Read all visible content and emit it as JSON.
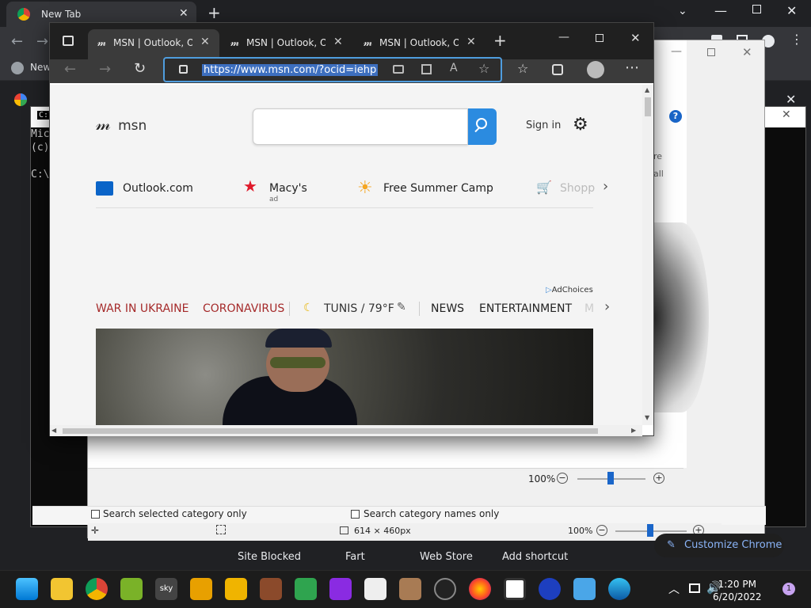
{
  "chrome": {
    "tab_title": "New Tab",
    "bookmarks_first": "New",
    "customize_label": "Customize Chrome",
    "shortcuts": [
      "Site Blocked",
      "Fart",
      "Web Store",
      "Add shortcut"
    ]
  },
  "cmd": {
    "title_icon": "C:\\",
    "lines": "Mic\n(c)\n\nC:\\"
  },
  "paint": {
    "zoom_top": "100%",
    "zoom_bottom": "100%",
    "image_size": "614 × 460px",
    "check_selected": "Search selected category only",
    "check_names": "Search category names only",
    "side_text_1": "re",
    "side_text_2": "all"
  },
  "edge": {
    "tabs": [
      {
        "label": "MSN | Outlook, Office"
      },
      {
        "label": "MSN | Outlook, Office"
      },
      {
        "label": "MSN | Outlook, Office"
      }
    ],
    "url": "https://www.msn.com/?ocid=iehp"
  },
  "msn": {
    "logo": "msn",
    "signin": "Sign in",
    "quicklinks": [
      {
        "label": "Outlook.com",
        "sub": ""
      },
      {
        "label": "Macy's",
        "sub": "ad"
      },
      {
        "label": "Free Summer Camp",
        "sub": ""
      },
      {
        "label": "Shopp",
        "sub": ""
      }
    ],
    "adchoices": "AdChoices",
    "nav": {
      "war": "WAR IN UKRAINE",
      "corona": "CORONAVIRUS",
      "weather": "TUNIS / 79°F",
      "news": "NEWS",
      "entertainment": "ENTERTAINMENT",
      "more": "M"
    }
  },
  "taskbar": {
    "time": "1:20 PM",
    "date": "6/20/2022",
    "badge": "1"
  }
}
